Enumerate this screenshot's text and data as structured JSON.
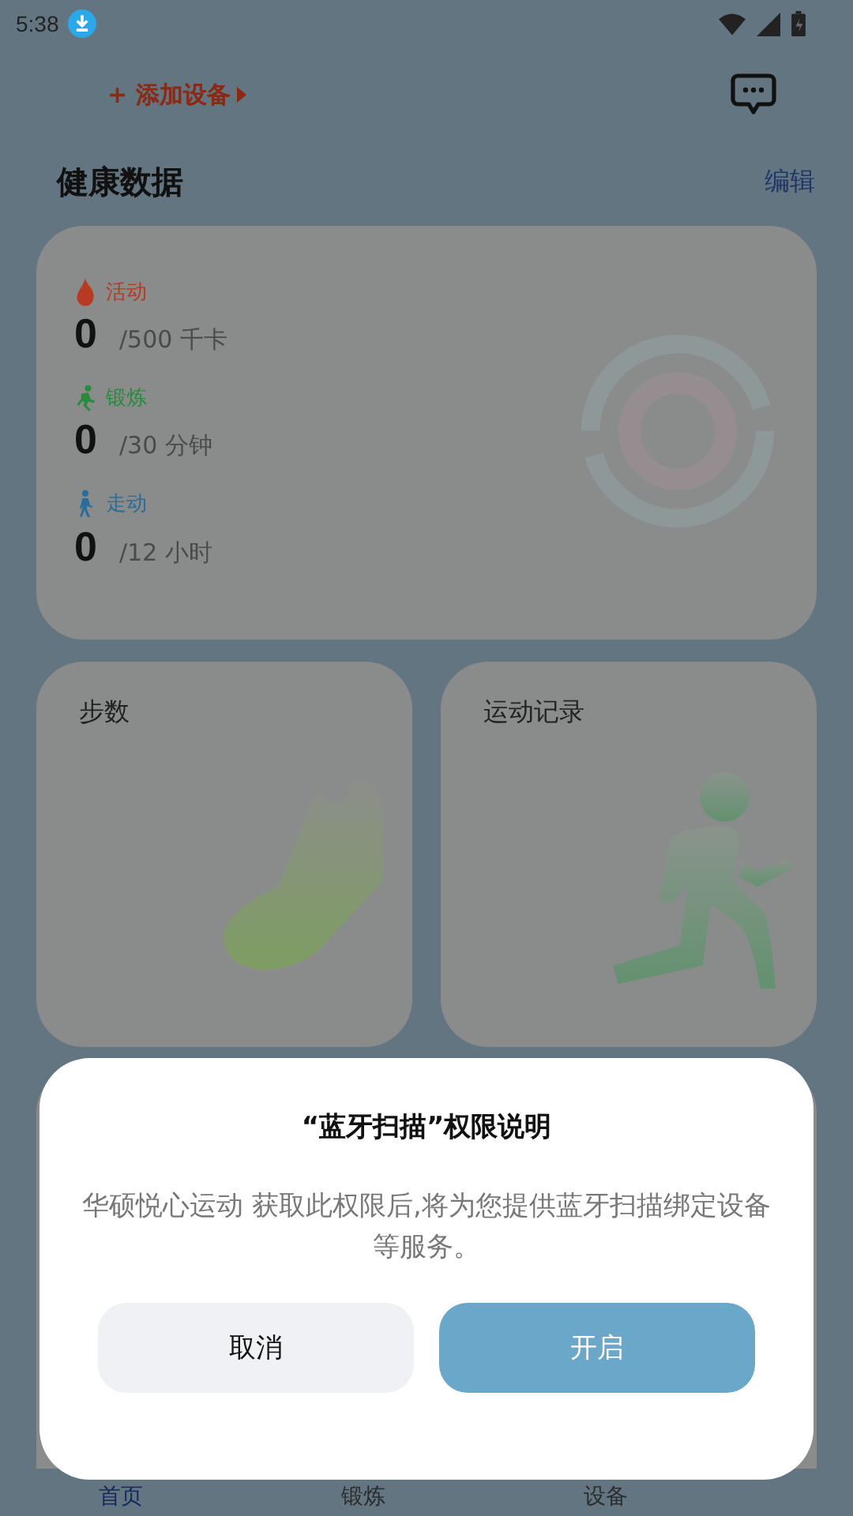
{
  "status_bar": {
    "time": "5:38"
  },
  "header": {
    "add_device": "+ 添加设备",
    "title": "健康数据",
    "edit": "编辑"
  },
  "activity_card": {
    "rows": [
      {
        "kind": "fire",
        "label": "活动",
        "color": "#b83a22",
        "value": "0",
        "goal": "/500 千卡"
      },
      {
        "kind": "run",
        "label": "锻炼",
        "color": "#2a8a3e",
        "value": "0",
        "goal": "/30 分钟"
      },
      {
        "kind": "walk",
        "label": "走动",
        "color": "#2a6c9a",
        "value": "0",
        "goal": "/12 小时"
      }
    ]
  },
  "tiles": [
    {
      "kind": "steps",
      "title": "步数"
    },
    {
      "kind": "records",
      "title": "运动记录"
    }
  ],
  "bottom_nav": [
    {
      "label": "首页",
      "selected": true
    },
    {
      "label": "锻炼",
      "selected": false
    },
    {
      "label": "设备",
      "selected": false
    }
  ],
  "dialog": {
    "title": "“蓝牙扫描”权限说明",
    "message": "华硕悦心运动 获取此权限后,将为您提供蓝牙扫描绑定设备等服务。",
    "buttons": [
      {
        "kind": "cancel",
        "label": "取消"
      },
      {
        "kind": "confirm",
        "label": "开启"
      }
    ]
  }
}
